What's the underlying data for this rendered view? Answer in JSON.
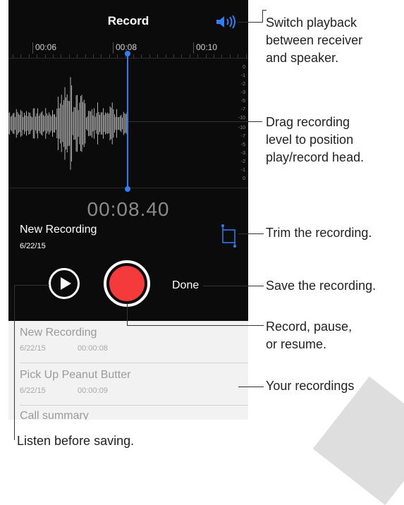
{
  "screen": {
    "title": "Record",
    "timeline_labels": [
      "00:06",
      "00:08",
      "00:10"
    ],
    "db_scale_top": [
      "0",
      "-1",
      "-2",
      "-3",
      "-5",
      "-7",
      "-10"
    ],
    "db_scale_bottom": [
      "-10",
      "-7",
      "-5",
      "-3",
      "-2",
      "-1",
      "0"
    ],
    "timer": "00:08.40",
    "recording_name": "New Recording",
    "recording_date": "6/22/15",
    "done_label": "Done"
  },
  "recordings": [
    {
      "title": "New Recording",
      "date": "6/22/15",
      "duration": "00:00:08"
    },
    {
      "title": "Pick Up Peanut Butter",
      "date": "6/22/15",
      "duration": "00:00:09"
    },
    {
      "title": "Call summary",
      "date": "",
      "duration": ""
    }
  ],
  "callouts": {
    "speaker": [
      "Switch playback",
      "between receiver",
      "and speaker."
    ],
    "drag": [
      "Drag recording",
      "level to position",
      "play/record head."
    ],
    "trim": "Trim the recording.",
    "save": "Save the recording.",
    "record": [
      "Record, pause,",
      "or resume."
    ],
    "list": "Your recordings",
    "listen": "Listen before saving."
  },
  "colors": {
    "accent": "#2f7ef5",
    "record_red": "#f43a3a",
    "screen_bg": "#0b0b0b",
    "list_bg": "#f2f2f2"
  },
  "icons": [
    "speaker-icon",
    "trim-icon",
    "play-icon",
    "record-icon"
  ]
}
